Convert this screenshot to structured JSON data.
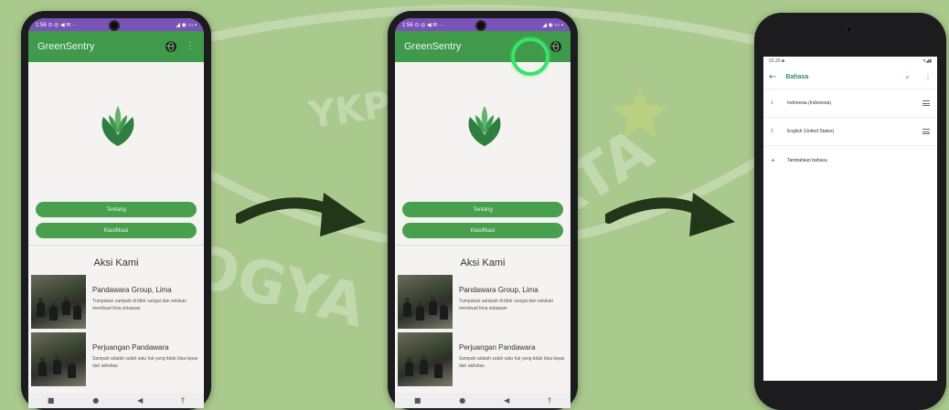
{
  "colors": {
    "background": "#a9c98d",
    "status_bar": "#7a52b8",
    "app_bar": "#3f9a4b",
    "button": "#48a04f",
    "highlight": "#39e26b",
    "settings_accent": "#2e8d6e",
    "arrow": "#22361a"
  },
  "phone1": {
    "status": {
      "time": "1:56",
      "icons": "⊙ ◎ ◀ ✉ ···",
      "right": "◢ ◉ ▭ ▪"
    },
    "app_title": "GreenSentry",
    "icons": [
      "globe-icon",
      "more-vert-icon"
    ],
    "buttons": {
      "tentang": "Tentang",
      "klasifikasi": "Klasifikasi"
    },
    "section_title": "Aksi Kami",
    "cards": [
      {
        "title": "Pandawara Group, Lima",
        "desc": "Tumpukan sampah di bibir sungai dan selokan membuat lima sekawan"
      },
      {
        "title": "Perjuangan Pandawara",
        "desc": "Sampah adalah salah satu hal yang tidak bisa lepas dari aktivitas"
      }
    ],
    "nav": [
      "■",
      "●",
      "◀",
      "†"
    ]
  },
  "phone2": {
    "status": {
      "time": "1:56",
      "icons": "⊙ ◎ ◀ ✉ ···",
      "right": "◢ ◉ ▭ ▪"
    },
    "app_title": "GreenSentry",
    "buttons": {
      "tentang": "Tentang",
      "klasifikasi": "Klasifikasi"
    },
    "section_title": "Aksi Kami",
    "cards": [
      {
        "title": "Pandawara Group, Lima",
        "desc": "Tumpukan sampah di bibir sungai dan selokan membuat lima sekawan"
      },
      {
        "title": "Perjuangan Pandawara",
        "desc": "Sampah adalah salah satu hal yang tidak bisa lepas dari aktivitas"
      }
    ],
    "nav": [
      "■",
      "●",
      "◀",
      "†"
    ]
  },
  "phone3": {
    "status": {
      "time": "02.20",
      "icons": "■",
      "right": "▾◢▮"
    },
    "title": "Bahasa",
    "icons": [
      "back-arrow-icon",
      "search-icon",
      "more-vert-icon"
    ],
    "languages": [
      {
        "num": "1",
        "name": "Indonesia (Indonesia)"
      },
      {
        "num": "2",
        "name": "English (United States)"
      }
    ],
    "add_label": "Tambahkan bahasa"
  },
  "watermark": {
    "top": "YKPN",
    "left": "YOGYA",
    "right": "KARTA"
  }
}
